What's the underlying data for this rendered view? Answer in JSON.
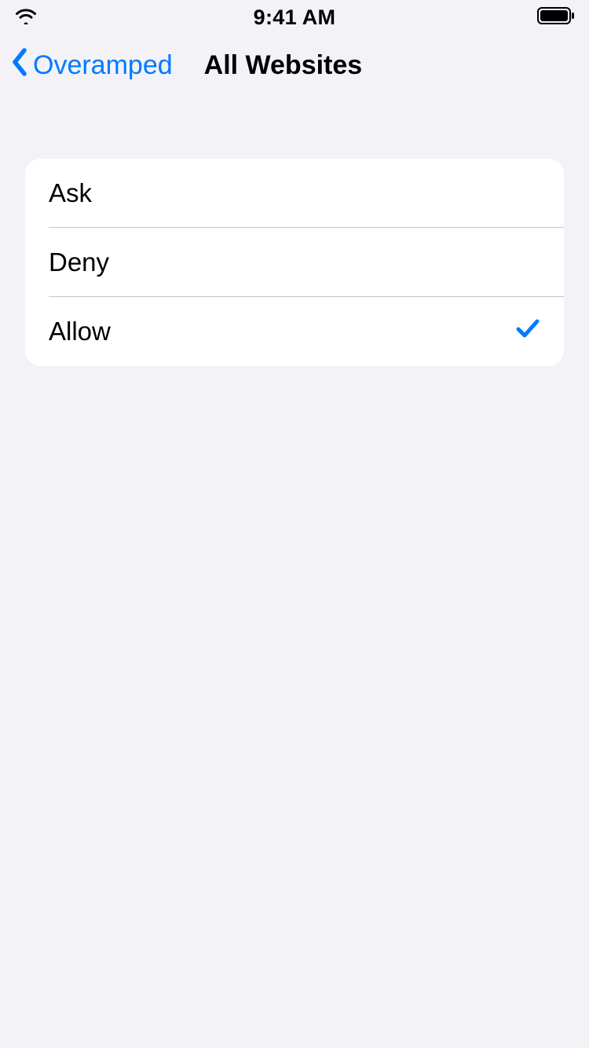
{
  "statusBar": {
    "time": "9:41 AM"
  },
  "nav": {
    "backLabel": "Overamped",
    "title": "All Websites"
  },
  "options": {
    "0": {
      "label": "Ask",
      "selected": false
    },
    "1": {
      "label": "Deny",
      "selected": false
    },
    "2": {
      "label": "Allow",
      "selected": true
    }
  },
  "colors": {
    "accent": "#007aff",
    "background": "#f2f2f7"
  }
}
